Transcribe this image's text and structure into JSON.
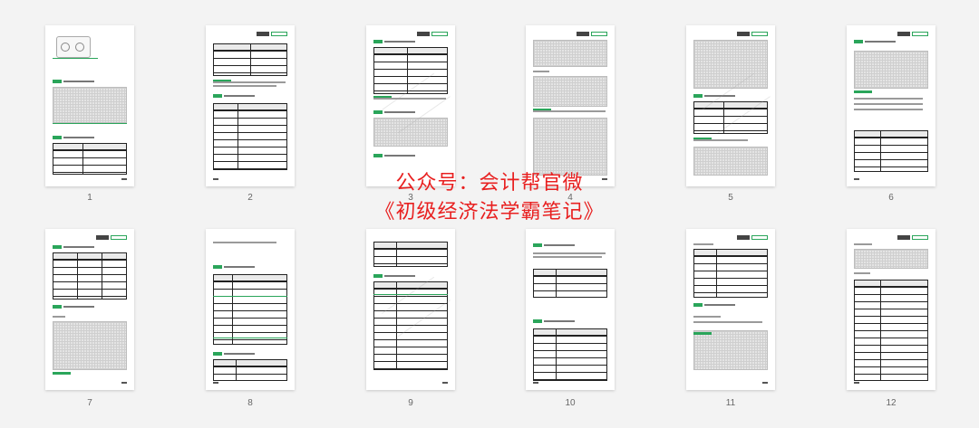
{
  "overlay": {
    "line1": "公众号：会计帮官微",
    "line2": "《初级经济法学霸笔记》"
  },
  "colors": {
    "accent_green": "#2aa55a",
    "overlay_red": "#e82020"
  },
  "pages": [
    {
      "number": "1"
    },
    {
      "number": "2"
    },
    {
      "number": "3"
    },
    {
      "number": "4"
    },
    {
      "number": "5"
    },
    {
      "number": "6"
    },
    {
      "number": "7"
    },
    {
      "number": "8"
    },
    {
      "number": "9"
    },
    {
      "number": "10"
    },
    {
      "number": "11"
    },
    {
      "number": "12"
    }
  ]
}
